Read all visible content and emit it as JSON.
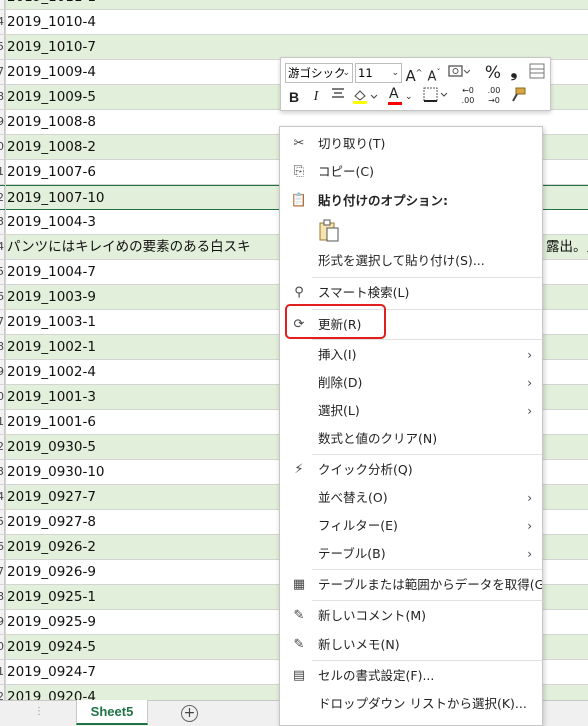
{
  "sheet": {
    "rows": [
      {
        "num": "3",
        "value": "2019_1011-1",
        "band": "green"
      },
      {
        "num": "4",
        "value": "2019_1010-4",
        "band": "white"
      },
      {
        "num": "5",
        "value": "2019_1010-7",
        "band": "green"
      },
      {
        "num": "7",
        "value": "2019_1009-4",
        "band": "white"
      },
      {
        "num": "8",
        "value": "2019_1009-5",
        "band": "green"
      },
      {
        "num": "9",
        "value": "2019_1008-8",
        "band": "white"
      },
      {
        "num": "0",
        "value": "2019_1008-2",
        "band": "green"
      },
      {
        "num": "1",
        "value": "2019_1007-6",
        "band": "white"
      },
      {
        "num": "2",
        "value": "2019_1007-10",
        "band": "green"
      },
      {
        "num": "3",
        "value": "2019_1004-3",
        "band": "white"
      },
      {
        "num": "4",
        "value": "パンツにはキレイめの要素のある白スキ",
        "band": "green",
        "overflow": "露出。足"
      },
      {
        "num": "5",
        "value": "2019_1004-7",
        "band": "white"
      },
      {
        "num": "6",
        "value": "2019_1003-9",
        "band": "green"
      },
      {
        "num": "7",
        "value": "2019_1003-1",
        "band": "white"
      },
      {
        "num": "8",
        "value": "2019_1002-1",
        "band": "green"
      },
      {
        "num": "9",
        "value": "2019_1002-4",
        "band": "white"
      },
      {
        "num": "0",
        "value": "2019_1001-3",
        "band": "green"
      },
      {
        "num": "1",
        "value": "2019_1001-6",
        "band": "white"
      },
      {
        "num": "2",
        "value": "2019_0930-5",
        "band": "green"
      },
      {
        "num": "3",
        "value": "2019_0930-10",
        "band": "white"
      },
      {
        "num": "4",
        "value": "2019_0927-7",
        "band": "green"
      },
      {
        "num": "5",
        "value": "2019_0927-8",
        "band": "white"
      },
      {
        "num": "6",
        "value": "2019_0926-2",
        "band": "green"
      },
      {
        "num": "7",
        "value": "2019_0926-9",
        "band": "white"
      },
      {
        "num": "8",
        "value": "2019_0925-1",
        "band": "green"
      },
      {
        "num": "9",
        "value": "2019_0925-9",
        "band": "white"
      },
      {
        "num": "0",
        "value": "2019_0924-5",
        "band": "green"
      },
      {
        "num": "1",
        "value": "2019_0924-7",
        "band": "white"
      },
      {
        "num": "2",
        "value": "2019_0920-4",
        "band": "green"
      }
    ],
    "selected_row_index": 8
  },
  "tabs": {
    "sheet_name": "Sheet5",
    "add_symbol": "+",
    "dots": "⋮"
  },
  "mini_toolbar": {
    "font_name": "游ゴシック",
    "font_size": "11",
    "grow_font": "A^",
    "shrink_font": "Aˇ",
    "percent": "%",
    "comma": "❟",
    "bold": "B",
    "italic": "I",
    "font_color_letter": "A",
    "increase_decimal": "←0 .00",
    "decrease_decimal": ".00 →0"
  },
  "context_menu": {
    "items": [
      {
        "label": "切り取り(T)",
        "icon": "scissors-icon",
        "glyph": "✂"
      },
      {
        "label": "コピー(C)",
        "icon": "copy-icon",
        "glyph": "⎘"
      },
      {
        "label": "貼り付けのオプション:",
        "icon": "paste-icon",
        "glyph": "📋"
      },
      {
        "label": "形式を選択して貼り付け(S)...",
        "icon": "",
        "glyph": ""
      },
      {
        "label": "スマート検索(L)",
        "icon": "smart-lookup-icon",
        "glyph": "⚲"
      },
      {
        "label": "更新(R)",
        "icon": "refresh-icon",
        "glyph": "⟳"
      },
      {
        "label": "挿入(I)",
        "icon": "",
        "glyph": "",
        "submenu": "›"
      },
      {
        "label": "削除(D)",
        "icon": "",
        "glyph": "",
        "submenu": "›"
      },
      {
        "label": "選択(L)",
        "icon": "",
        "glyph": "",
        "submenu": "›"
      },
      {
        "label": "数式と値のクリア(N)",
        "icon": "",
        "glyph": ""
      },
      {
        "label": "クイック分析(Q)",
        "icon": "quick-analysis-icon",
        "glyph": "⚡"
      },
      {
        "label": "並べ替え(O)",
        "icon": "",
        "glyph": "",
        "submenu": "›"
      },
      {
        "label": "フィルター(E)",
        "icon": "",
        "glyph": "",
        "submenu": "›"
      },
      {
        "label": "テーブル(B)",
        "icon": "",
        "glyph": "",
        "submenu": "›"
      },
      {
        "label": "テーブルまたは範囲からデータを取得(G)...",
        "icon": "table-icon",
        "glyph": "▦"
      },
      {
        "label": "新しいコメント(M)",
        "icon": "new-comment-icon",
        "glyph": "✎"
      },
      {
        "label": "新しいメモ(N)",
        "icon": "new-note-icon",
        "glyph": "✎"
      },
      {
        "label": "セルの書式設定(F)...",
        "icon": "format-cells-icon",
        "glyph": "▤"
      },
      {
        "label": "ドロップダウン リストから選択(K)...",
        "icon": "",
        "glyph": ""
      }
    ],
    "highlighted": "更新(R)"
  },
  "colors": {
    "band_green": "#e2efda",
    "excel_green": "#217346",
    "highlight_red": "#e21f1f",
    "fill_yellow": "#ffff00",
    "font_red": "#ff0000"
  }
}
